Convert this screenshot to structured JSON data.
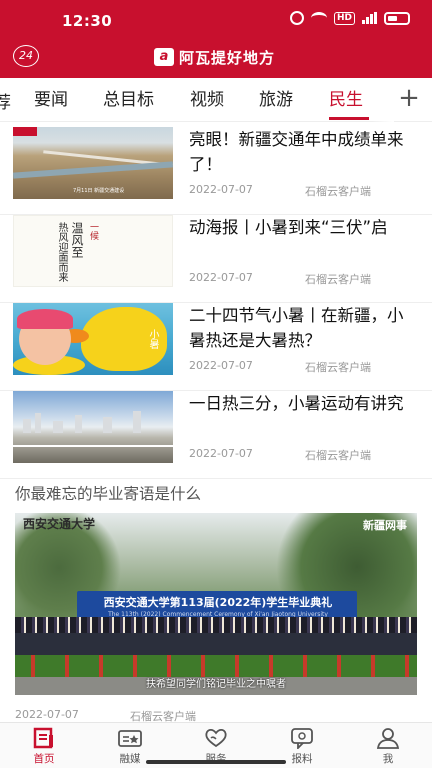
{
  "status_bar": {
    "time": "12:30",
    "network": "HD",
    "signal": "5G"
  },
  "header": {
    "badge": "24",
    "brand_mark": "a",
    "brand_name": "阿瓦提好地方"
  },
  "tabs": {
    "partial": "荐",
    "items": [
      {
        "label": "要闻"
      },
      {
        "label": "总目标"
      },
      {
        "label": "视频"
      },
      {
        "label": "旅游"
      },
      {
        "label": "民生",
        "active": true
      }
    ],
    "add_label": "+"
  },
  "news": [
    {
      "title": "亮眼！新疆交通年中成绩单来了！",
      "date": "2022-07-07",
      "source": "石榴云客户端",
      "thumb": "road-bridge",
      "thumb_caption": "7月11日 新疆交通建设"
    },
    {
      "title": "动海报丨小暑到来“三伏”启",
      "date": "2022-07-07",
      "source": "石榴云客户端",
      "thumb": "solar-term-poster",
      "thumb_text": [
        "一候",
        "温风至",
        "热风迎面而来"
      ]
    },
    {
      "title": "二十四节气小暑丨在新疆，小暑热还是大暑热？",
      "date": "2022-07-07",
      "source": "石榴云客户端",
      "thumb": "baby-duck",
      "thumb_text": "小暑"
    },
    {
      "title": "一日热三分，小暑运动有讲究",
      "date": "2022-07-07",
      "source": "石榴云客户端",
      "thumb": "city-river"
    }
  ],
  "feature": {
    "title": "你最难忘的毕业寄语是什么",
    "image_sign": "西安交通大学",
    "image_logo": "新疆网事",
    "banner": "西安交通大学第113届(2022年)学生毕业典礼",
    "banner_sub": "The 113th (2022) Commencement Ceremony of Xi'an Jiaotong University",
    "caption": "扶希望同学们铭记毕业之中嘱者",
    "date": "2022-07-07",
    "source": "石榴云客户端"
  },
  "bottom_nav": [
    {
      "label": "首页",
      "icon": "home-doc-icon",
      "active": true
    },
    {
      "label": "融媒",
      "icon": "media-card-icon"
    },
    {
      "label": "服务",
      "icon": "heart-hands-icon"
    },
    {
      "label": "报料",
      "icon": "report-chat-icon"
    },
    {
      "label": "我",
      "icon": "person-icon"
    }
  ],
  "colors": {
    "accent": "#c8102e",
    "text": "#111111",
    "muted": "#999999"
  }
}
